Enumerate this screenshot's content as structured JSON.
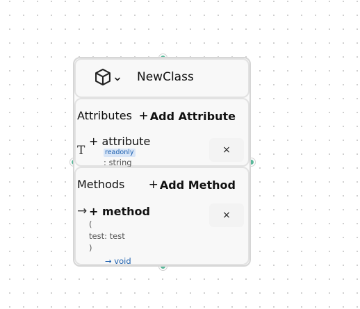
{
  "class_node": {
    "name": "NewClass",
    "type_icon": "cube-icon",
    "type_menu_icon": "chevron-down-icon"
  },
  "attributes": {
    "title": "Attributes",
    "add_label": "Add Attribute",
    "add_icon": "+",
    "items": [
      {
        "visibility_name": "+ attribute",
        "badge": "readonly",
        "type": ": string",
        "icon": "text-type-icon",
        "icon_glyph": "T",
        "delete_glyph": "×"
      }
    ]
  },
  "methods": {
    "title": "Methods",
    "add_label": "Add Method",
    "add_icon": "+",
    "items": [
      {
        "visibility_name": "+ method",
        "icon": "arrow-right-icon",
        "icon_glyph": "→",
        "open_paren": "(",
        "params": [
          "test: test"
        ],
        "close_paren": ")",
        "return_type": "→ void",
        "delete_glyph": "×"
      }
    ]
  },
  "colors": {
    "handle": "#5ab89a",
    "badge_text": "#1c5fae",
    "badge_bg": "#d9e6f7",
    "return_type": "#1c5fae"
  }
}
